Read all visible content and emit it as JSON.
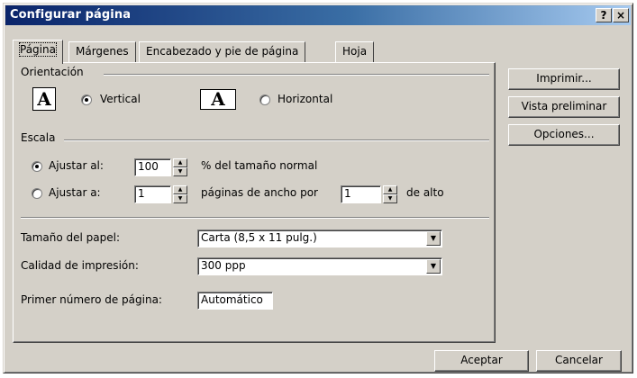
{
  "window": {
    "title": "Configurar página",
    "help_button": "?",
    "close_button": "×"
  },
  "tabs": [
    {
      "label": "Página",
      "active": true
    },
    {
      "label": "Márgenes",
      "active": false
    },
    {
      "label": "Encabezado y pie de página",
      "active": false
    },
    {
      "label": "Hoja",
      "active": false
    }
  ],
  "orientation": {
    "section_label": "Orientación",
    "vertical_icon": "A",
    "vertical_label": "Vertical",
    "horizontal_icon": "A",
    "horizontal_label": "Horizontal",
    "selected": "vertical"
  },
  "scale": {
    "section_label": "Escala",
    "fit_to_label": "Ajustar al:",
    "fit_to_value": "100",
    "fit_to_suffix": "% del tamaño normal",
    "fit_pages_label": "Ajustar a:",
    "pages_wide_value": "1",
    "pages_wide_suffix": "páginas de ancho por",
    "pages_tall_value": "1",
    "pages_tall_suffix": "de alto",
    "selected": "ajustar_al"
  },
  "paper": {
    "size_label": "Tamaño del papel:",
    "size_value": "Carta (8,5 x 11 pulg.)",
    "quality_label": "Calidad de impresión:",
    "quality_value": "300 ppp",
    "first_page_label": "Primer número de página:",
    "first_page_value": "Automático"
  },
  "side_buttons": {
    "print": "Imprimir...",
    "preview": "Vista preliminar",
    "options": "Opciones..."
  },
  "footer": {
    "ok": "Aceptar",
    "cancel": "Cancelar"
  }
}
